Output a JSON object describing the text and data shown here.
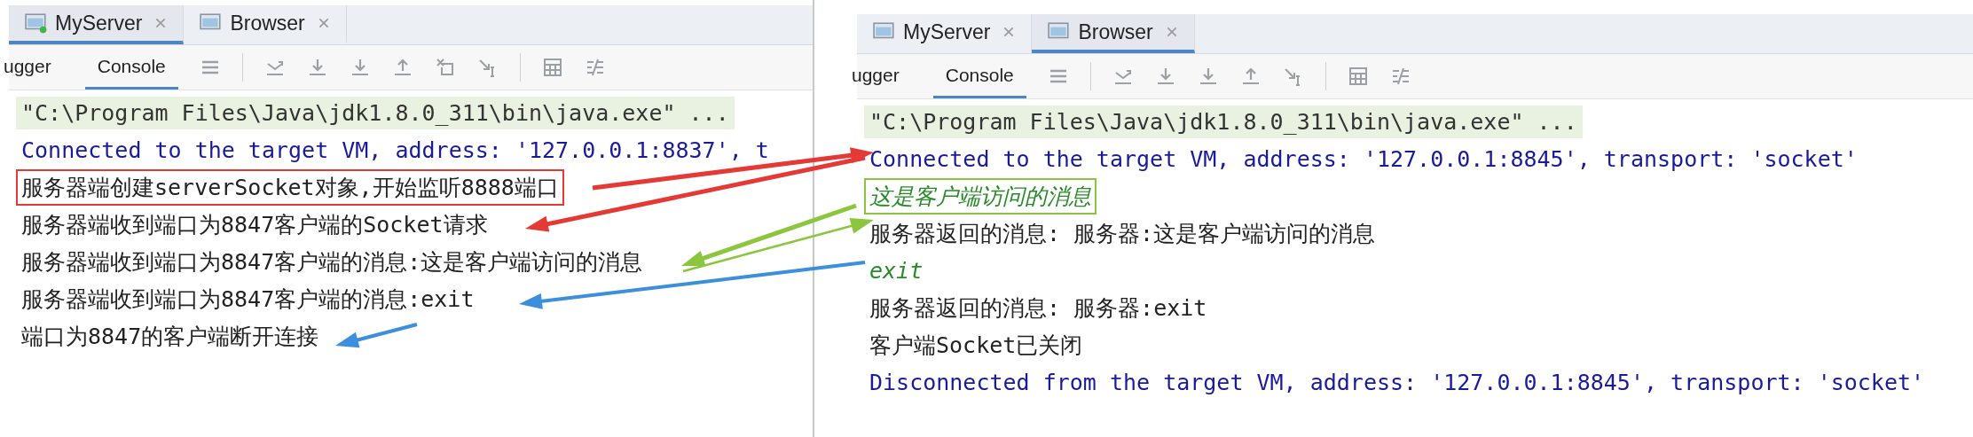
{
  "panels": [
    {
      "tabs": [
        {
          "label": "MyServer",
          "selected": true,
          "running": true
        },
        {
          "label": "Browser",
          "selected": false,
          "running": false
        }
      ],
      "toolbar_tabs": [
        {
          "label": "ugger",
          "selected": false
        },
        {
          "label": "Console",
          "selected": true
        }
      ],
      "lines": [
        {
          "text": "\"C:\\Program Files\\Java\\jdk1.8.0_311\\bin\\java.exe\" ...",
          "kind": "command",
          "boxed": false
        },
        {
          "text": "Connected to the target VM, address: '127.0.0.1:8837', t",
          "kind": "system",
          "boxed": false
        },
        {
          "text": "服务器端创建serverSocket对象,开始监听8888端口",
          "kind": "output",
          "boxed": true,
          "color": "#e53935"
        },
        {
          "text": "服务器端收到端口为8847客户端的Socket请求",
          "kind": "output",
          "boxed": false
        },
        {
          "text": "服务器端收到端口为8847客户端的消息:这是客户端访问的消息",
          "kind": "output",
          "boxed": false
        },
        {
          "text": "服务器端收到端口为8847客户端的消息:exit",
          "kind": "output",
          "boxed": false
        },
        {
          "text": "端口为8847的客户端断开连接",
          "kind": "output",
          "boxed": false
        }
      ]
    },
    {
      "tabs": [
        {
          "label": "MyServer",
          "selected": false,
          "running": false
        },
        {
          "label": "Browser",
          "selected": true,
          "running": false
        }
      ],
      "toolbar_tabs": [
        {
          "label": "ugger",
          "selected": false
        },
        {
          "label": "Console",
          "selected": true
        }
      ],
      "lines": [
        {
          "text": "\"C:\\Program Files\\Java\\jdk1.8.0_311\\bin\\java.exe\" ...",
          "kind": "command",
          "boxed": false
        },
        {
          "text": "Connected to the target VM, address: '127.0.0.1:8845', transport: 'socket'",
          "kind": "system",
          "boxed": false
        },
        {
          "text": "这是客户端访问的消息",
          "kind": "input",
          "boxed": true,
          "color": "#8cc63f"
        },
        {
          "text": "服务器返回的消息: 服务器:这是客户端访问的消息",
          "kind": "output",
          "boxed": false
        },
        {
          "text": "exit",
          "kind": "input",
          "boxed": false
        },
        {
          "text": "服务器返回的消息: 服务器:exit",
          "kind": "output",
          "boxed": false
        },
        {
          "text": "客户端Socket已关闭",
          "kind": "output",
          "boxed": false
        },
        {
          "text": "Disconnected from the target VM, address: '127.0.0.1:8845', transport: 'socket'",
          "kind": "system",
          "boxed": false
        }
      ]
    }
  ],
  "annotations": [
    {
      "color": "#e53935"
    },
    {
      "color": "#e53935"
    },
    {
      "color": "#8cc63f"
    },
    {
      "color": "#8cc63f"
    },
    {
      "color": "#3b8fdc"
    },
    {
      "color": "#3b8fdc"
    }
  ]
}
